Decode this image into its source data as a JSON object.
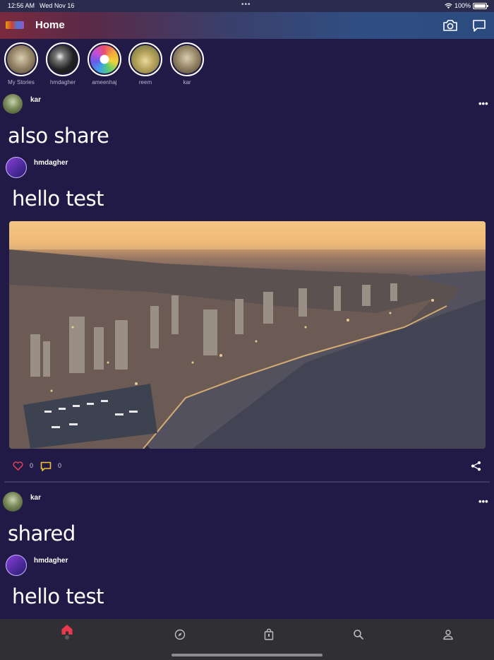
{
  "status_bar": {
    "time": "12:56 AM",
    "date": "Wed Nov 16",
    "battery": "100%"
  },
  "header": {
    "title": "Home",
    "camera_icon": "camera-icon",
    "chat_icon": "chat-icon"
  },
  "stories": [
    {
      "label": "My Stories",
      "color": "#8a7a5a"
    },
    {
      "label": "hmdagher",
      "color": "#3a3a3a"
    },
    {
      "label": "ameenhaj",
      "color": "#ffffff"
    },
    {
      "label": "reem",
      "color": "#b9a25c"
    },
    {
      "label": "kar",
      "color": "#8a7a5a"
    }
  ],
  "posts": [
    {
      "author": "kar",
      "text": "also share",
      "shared": {
        "author": "hmdagher",
        "text": "hello test"
      },
      "likes": "0",
      "comments": "0"
    },
    {
      "author": "kar",
      "text": "shared",
      "shared": {
        "author": "hmdagher",
        "text": "hello test"
      }
    }
  ],
  "colors": {
    "background": "#221a46",
    "like": "#e0405a",
    "comment": "#f1c232",
    "nav_active": "#e8394d",
    "nav_bar": "#2f2f34"
  },
  "nav": [
    "home-icon",
    "compass-icon",
    "bag-icon",
    "search-icon",
    "profile-icon"
  ]
}
